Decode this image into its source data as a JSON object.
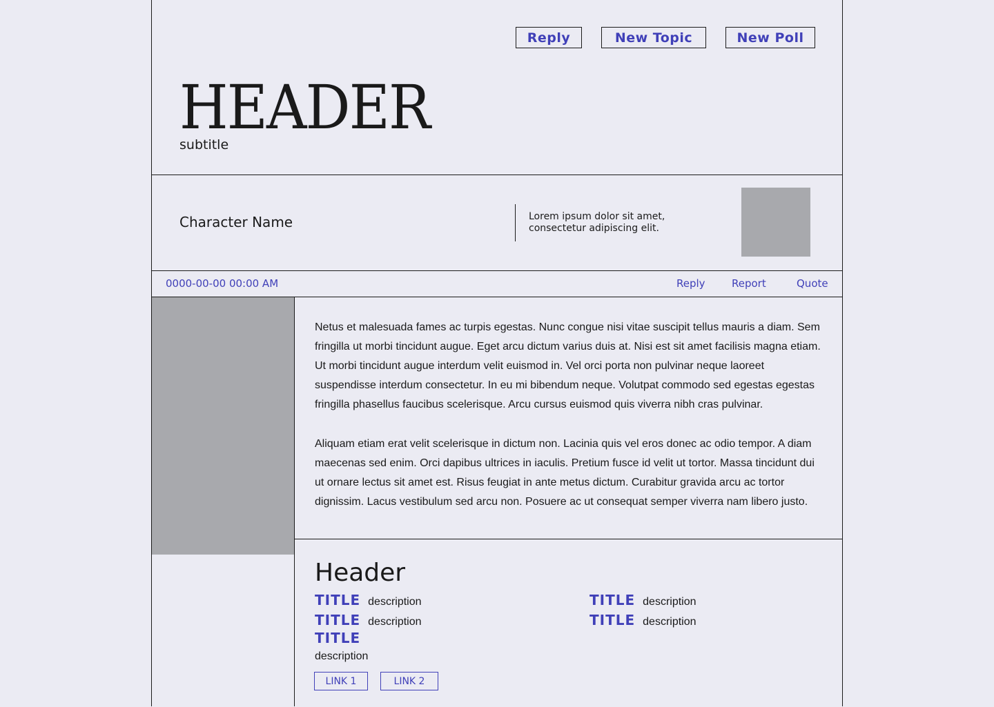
{
  "toolbar": {
    "reply": "Reply",
    "new_topic": "New Topic",
    "new_poll": "New Poll"
  },
  "header": {
    "title": "HEADER",
    "subtitle": "subtitle"
  },
  "character": {
    "name": "Character Name",
    "quote": "Lorem ipsum dolor sit amet, consectetur adipiscing elit."
  },
  "meta": {
    "timestamp": "0000-00-00 00:00 AM",
    "reply": "Reply",
    "report": "Report",
    "quote": "Quote"
  },
  "post": {
    "paragraphs": [
      "Netus et malesuada fames ac turpis egestas. Nunc congue nisi vitae  suscipit tellus mauris a diam. Sem fringilla ut morbi tincidunt augue.  Eget arcu dictum varius duis at. Nisi est sit amet facilisis magna etiam. Ut morbi tincidunt augue interdum velit euismod in. Vel orci  porta non pulvinar neque laoreet suspendisse interdum consectetur. In eu  mi bibendum neque. Volutpat commodo sed egestas egestas fringilla  phasellus faucibus scelerisque. Arcu cursus euismod quis viverra nibh  cras pulvinar.",
      "Aliquam etiam erat velit scelerisque in dictum non. Lacinia quis vel  eros donec ac odio tempor. A diam maecenas sed enim. Orci dapibus  ultrices in iaculis. Pretium fusce id velit ut tortor. Massa tincidunt dui ut ornare lectus sit amet est. Risus feugiat in ante metus dictum.  Curabitur gravida arcu ac tortor dignissim. Lacus vestibulum sed arcu  non. Posuere ac ut consequat semper viverra nam libero justo."
    ]
  },
  "signature": {
    "header": "Header",
    "items": [
      {
        "title": "TITLE",
        "description": "description"
      },
      {
        "title": "TITLE",
        "description": "description"
      },
      {
        "title": "TITLE",
        "description": "description"
      },
      {
        "title": "TITLE",
        "description": "description"
      },
      {
        "title": "TITLE",
        "description": "description"
      }
    ],
    "links": [
      "LINK 1",
      "LINK 2"
    ]
  },
  "colors": {
    "accent": "#4040b8",
    "background": "#ebebf3",
    "placeholder": "#a8a9ad"
  }
}
